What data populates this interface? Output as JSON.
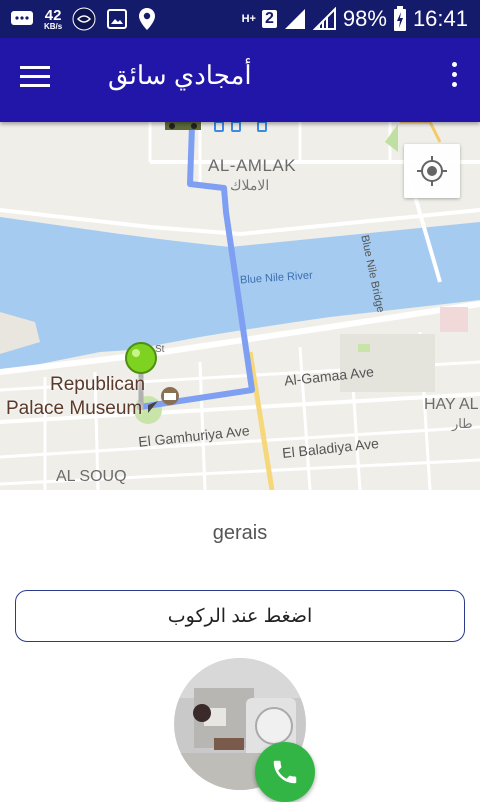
{
  "status_bar": {
    "net_speed": "42",
    "net_unit": "KB/s",
    "sim_label": "2",
    "network_type": "H+",
    "battery": "98%",
    "time": "16:41"
  },
  "app_bar": {
    "title": "أمجادي سائق",
    "menu_icon": "hamburger-menu-icon",
    "more_icon": "more-vertical-icon"
  },
  "map": {
    "labels": {
      "al_amlak": "AL-AMLAK",
      "al_amlak_ar": "الاملاك",
      "blue_nile_river": "Blue Nile River",
      "blue_nile_bridge": "Blue Nile Bridge",
      "republican_1": "Republican",
      "republican_2": "Palace Museum",
      "st": "St",
      "al_gamaa": "Al-Gamaa Ave",
      "el_gamhuriya": "El Gamhuriya Ave",
      "el_baladiya": "El Baladiya Ave",
      "al_souq": "AL SOUQ",
      "hay_al": "HAY AL",
      "hay_al_ar": "طار"
    },
    "route_color": "#7e9ff2",
    "water_color": "#a5cbf1",
    "pin_color": "#7ed321"
  },
  "driver": {
    "name": "gerais"
  },
  "actions": {
    "board_label": "اضغط عند الركوب"
  },
  "colors": {
    "status_bar": "#151b6b",
    "app_bar": "#2116a8",
    "call_button": "#33b545",
    "button_border": "#2b3a8c"
  }
}
